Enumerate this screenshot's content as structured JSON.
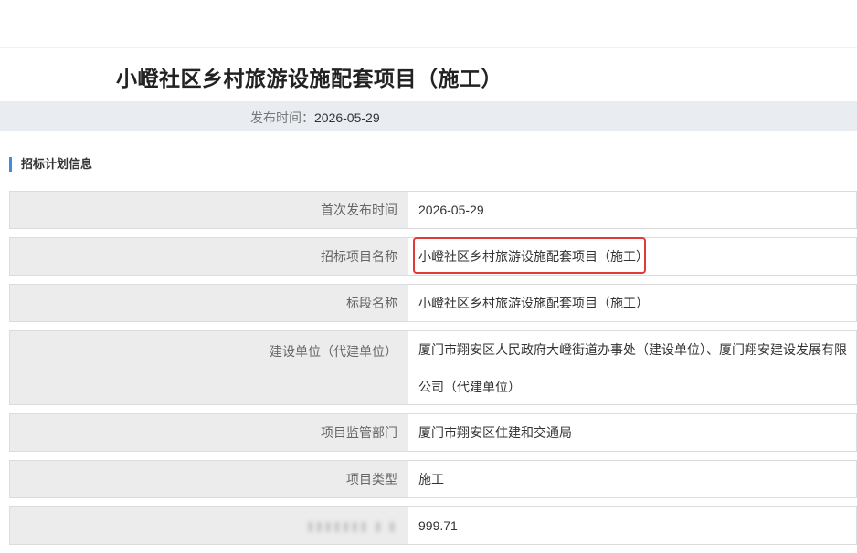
{
  "page": {
    "title": "小嶝社区乡村旅游设施配套项目（施工）",
    "publish_label": "发布时间：",
    "publish_date": "2026-05-29"
  },
  "section": {
    "title": "招标计划信息"
  },
  "rows": [
    {
      "label": "首次发布时间",
      "value": "2026-05-29"
    },
    {
      "label": "招标项目名称",
      "value": "小嶝社区乡村旅游设施配套项目（施工）"
    },
    {
      "label": "标段名称",
      "value": "小嶝社区乡村旅游设施配套项目（施工）"
    },
    {
      "label": "建设单位（代建单位）",
      "value": "厦门市翔安区人民政府大嶝街道办事处（建设单位）、厦门翔安建设发展有限公司（代建单位）"
    },
    {
      "label": "项目监管部门",
      "value": "厦门市翔安区住建和交通局"
    },
    {
      "label": "项目类型",
      "value": "施工"
    },
    {
      "label": "",
      "value": "999.71"
    }
  ],
  "colors": {
    "accent": "#3f8ddc",
    "highlight": "#e03a3a",
    "label_bg": "#ececec",
    "meta_bar_bg": "#e9edf1"
  }
}
